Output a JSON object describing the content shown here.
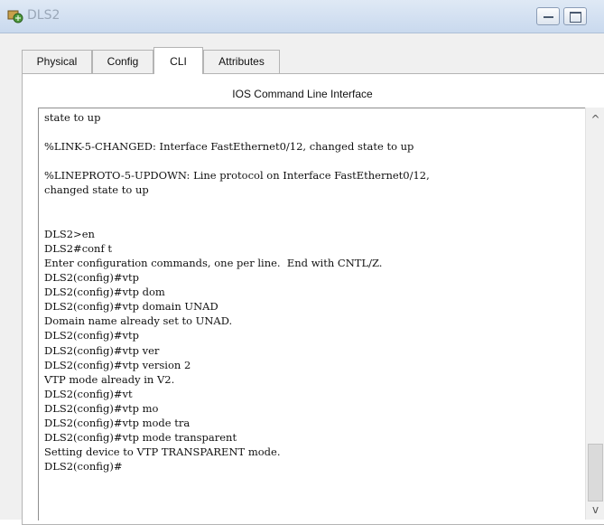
{
  "window": {
    "title": "DLS2",
    "icon": "packet-tracer-icon",
    "controls": [
      "minimize-icon",
      "maximize-icon"
    ]
  },
  "tabs": [
    {
      "label": "Physical",
      "active": false
    },
    {
      "label": "Config",
      "active": false
    },
    {
      "label": "CLI",
      "active": true
    },
    {
      "label": "Attributes",
      "active": false
    }
  ],
  "cli": {
    "heading": "IOS Command Line Interface",
    "lines": [
      "state to up",
      "",
      "%LINK-5-CHANGED: Interface FastEthernet0/12, changed state to up",
      "",
      "%LINEPROTO-5-UPDOWN: Line protocol on Interface FastEthernet0/12,",
      "changed state to up",
      "",
      "",
      "DLS2>en",
      "DLS2#conf t",
      "Enter configuration commands, one per line.  End with CNTL/Z.",
      "DLS2(config)#vtp",
      "DLS2(config)#vtp dom",
      "DLS2(config)#vtp domain UNAD",
      "Domain name already set to UNAD.",
      "DLS2(config)#vtp",
      "DLS2(config)#vtp ver",
      "DLS2(config)#vtp version 2",
      "VTP mode already in V2.",
      "DLS2(config)#vt",
      "DLS2(config)#vtp mo",
      "DLS2(config)#vtp mode tra",
      "DLS2(config)#vtp mode transparent",
      "Setting device to VTP TRANSPARENT mode.",
      "DLS2(config)#"
    ]
  },
  "scrollbar": {
    "up_glyph": "^",
    "down_glyph": "v"
  }
}
